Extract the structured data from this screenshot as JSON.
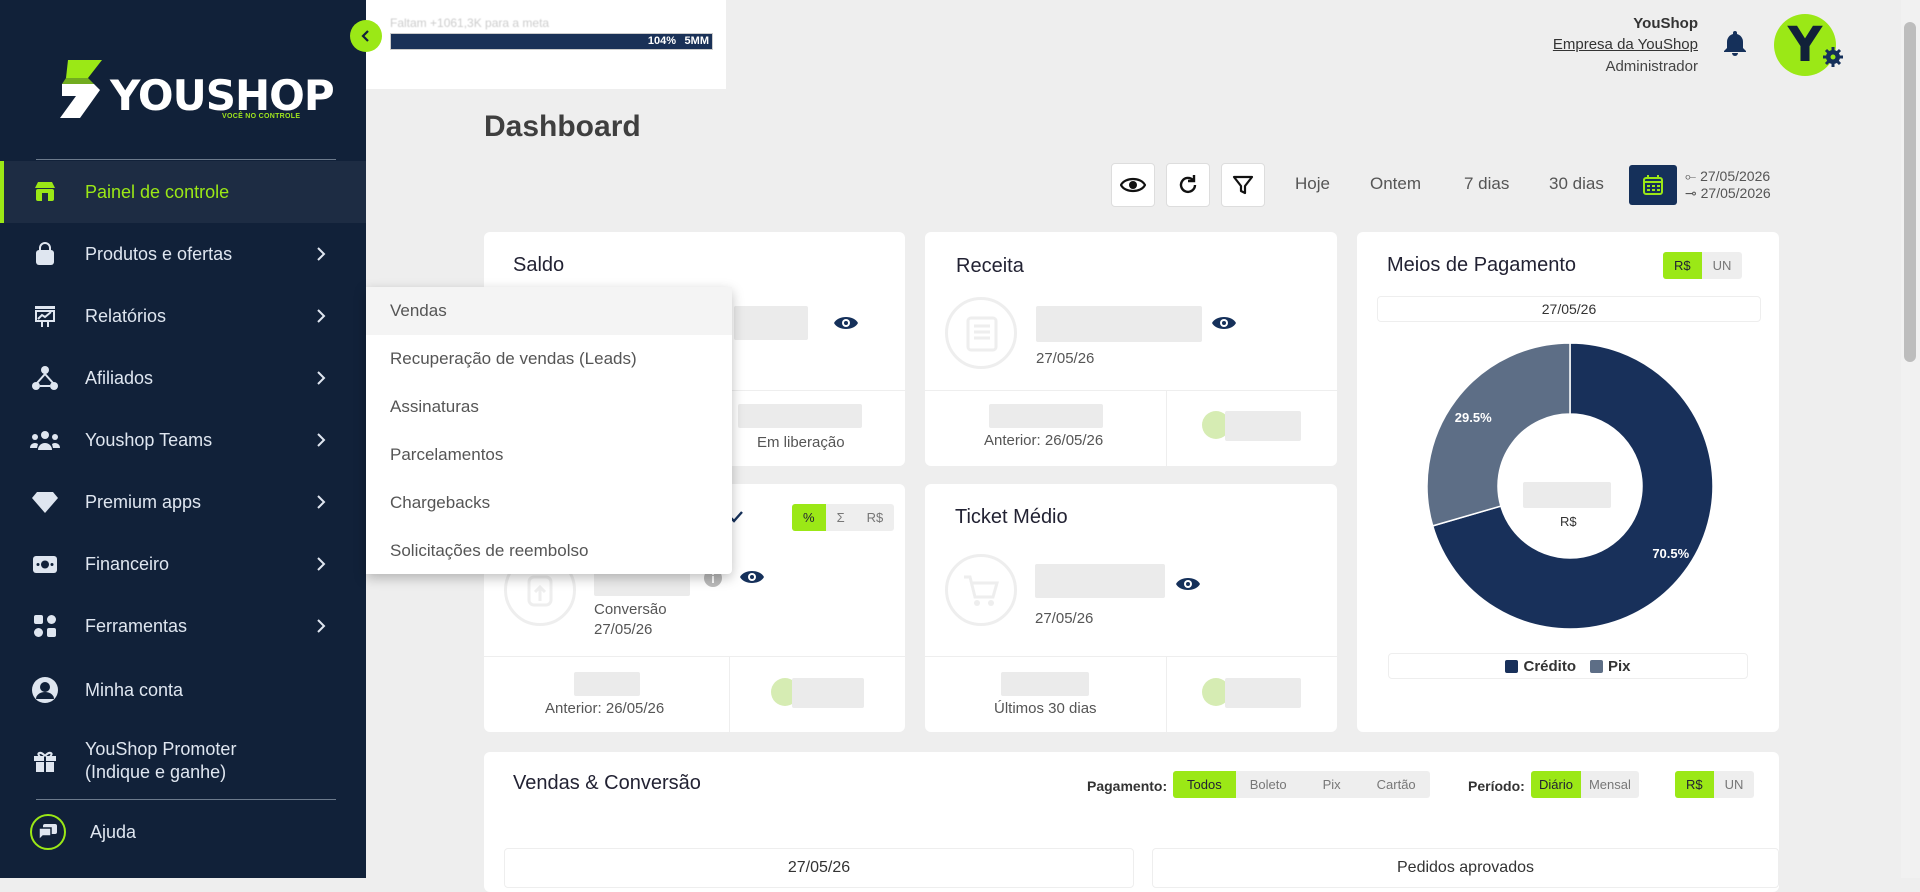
{
  "brand": {
    "name": "YOUSHOP",
    "tagline": "VOCÊ NO CONTROLE"
  },
  "sidebar": {
    "items": [
      {
        "label": "Painel de controle",
        "icon": "store-icon",
        "active": true
      },
      {
        "label": "Produtos e ofertas",
        "icon": "bag-icon"
      },
      {
        "label": "Relatórios",
        "icon": "report-icon"
      },
      {
        "label": "Afiliados",
        "icon": "network-icon"
      },
      {
        "label": "Youshop Teams",
        "icon": "team-icon"
      },
      {
        "label": "Premium apps",
        "icon": "diamond-icon"
      },
      {
        "label": "Financeiro",
        "icon": "money-icon"
      },
      {
        "label": "Ferramentas",
        "icon": "tools-icon"
      },
      {
        "label": "Minha conta",
        "icon": "user-icon"
      },
      {
        "label_line1": "YouShop Promoter",
        "label_line2": "(Indique e ganhe)",
        "icon": "gift-icon"
      }
    ],
    "help": "Ajuda"
  },
  "header": {
    "goal_text": "Faltam +1061,3K para a meta",
    "goal_percent": "104%",
    "goal_target": "5MM",
    "user_name": "YouShop",
    "company": "Empresa da YouShop",
    "role": "Administrador",
    "avatar_letter": "Y"
  },
  "page": {
    "title": "Dashboard"
  },
  "toolbar": {
    "ranges": [
      "Hoje",
      "Ontem",
      "7 dias",
      "30 dias"
    ],
    "date_from": "27/05/2026",
    "date_to": "27/05/2026"
  },
  "dropdown": {
    "items": [
      "Vendas",
      "Recuperação de vendas (Leads)",
      "Assinaturas",
      "Parcelamentos",
      "Chargebacks",
      "Solicitações de reembolso"
    ]
  },
  "saldo": {
    "title": "Saldo",
    "release_label": "Em liberação"
  },
  "receita": {
    "title": "Receita",
    "date": "27/05/26",
    "previous": "Anterior: 26/05/26"
  },
  "conversao": {
    "toggle": [
      "%",
      "Σ",
      "R$"
    ],
    "label": "Conversão",
    "date": "27/05/26",
    "previous": "Anterior: 26/05/26"
  },
  "ticket": {
    "title": "Ticket Médio",
    "date": "27/05/26",
    "previous": "Últimos 30 dias"
  },
  "meios": {
    "title": "Meios de Pagamento",
    "toggle": [
      "R$",
      "UN"
    ],
    "date": "27/05/26",
    "center_label": "R$",
    "legend": [
      "Crédito",
      "Pix"
    ],
    "colors": {
      "credito": "#18305a",
      "pix": "#5d6e86"
    }
  },
  "chart_data": {
    "type": "pie",
    "categories": [
      "Crédito",
      "Pix"
    ],
    "values": [
      70.5,
      29.5
    ],
    "labels": [
      "70.5%",
      "29.5%"
    ]
  },
  "vendas": {
    "title": "Vendas & Conversão",
    "payment_label": "Pagamento:",
    "payment_options": [
      "Todos",
      "Boleto",
      "Pix",
      "Cartão"
    ],
    "period_label": "Período:",
    "period_options": [
      "Diário",
      "Mensal"
    ],
    "unit_options": [
      "R$",
      "UN"
    ],
    "left_header": "27/05/26",
    "right_header": "Pedidos aprovados"
  },
  "colors": {
    "accent": "#9be816",
    "navy": "#112139",
    "navy_button": "#15305a"
  }
}
